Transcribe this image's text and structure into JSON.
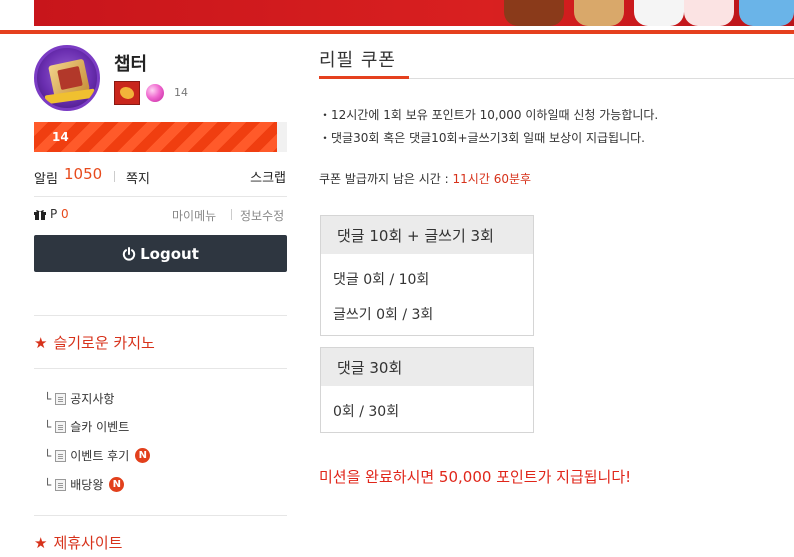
{
  "user": {
    "name": "챕터",
    "level": "14",
    "progress_label": "14",
    "progress_fraction": 0.96
  },
  "account": {
    "alarm_label": "알림",
    "alarm_count": "1050",
    "note_label": "쪽지",
    "scrap_label": "스크랩",
    "point_label": "P",
    "point_value": "0",
    "mymenu_label": "마이메뉴",
    "profile_edit_label": "정보수정",
    "logout_label": "Logout"
  },
  "sidebar": {
    "casino_title": "슬기로운 카지노",
    "items": [
      {
        "label": "공지사항",
        "new": ""
      },
      {
        "label": "슬카 이벤트",
        "new": ""
      },
      {
        "label": "이벤트 후기",
        "new": "N"
      },
      {
        "label": "배당왕",
        "new": "N"
      }
    ],
    "partner_title": "제휴사이트"
  },
  "main": {
    "title": "리필 쿠폰",
    "info_lines": [
      "・12시간에 1회 보유 포인트가 10,000 이하일때 신청 가능합니다.",
      "・댓글30회 혹은 댓글10회+글쓰기3회 일때 보상이 지급됩니다."
    ],
    "remain_label": "쿠폰 발급까지 남은 시간 :",
    "remain_value": "11시간 60분후",
    "box1": {
      "header": "댓글 10회 + 글쓰기 3회",
      "rows": [
        "댓글 0회 / 10회",
        "글쓰기 0회 / 3회"
      ]
    },
    "box2": {
      "header": "댓글 30회",
      "rows": [
        "0회 / 30회"
      ]
    },
    "mission_text": "미션을 완료하시면 50,000 포인트가 지급됩니다!"
  },
  "colors": {
    "accent": "#e5401e",
    "red_text": "#d7321b",
    "logout_bg": "#2e3640"
  }
}
